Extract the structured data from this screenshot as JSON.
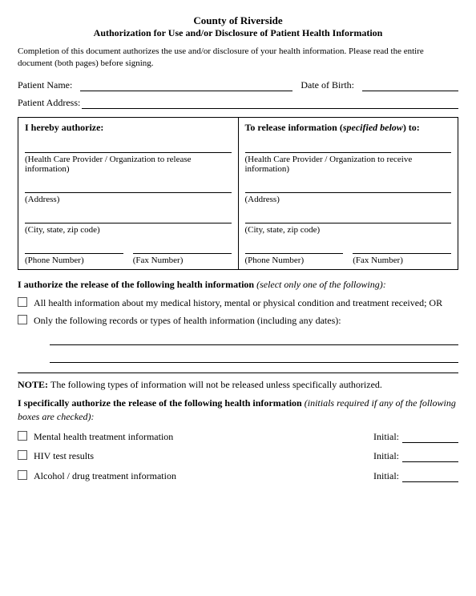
{
  "header": {
    "title": "County of Riverside",
    "subtitle": "Authorization for Use and/or Disclosure of Patient Health Information"
  },
  "intro": {
    "text": "Completion of this document authorizes the use and/or disclosure of your health information.  Please read the entire document (both pages) before signing."
  },
  "fields": {
    "patient_name_label": "Patient Name:",
    "date_of_birth_label": "Date of Birth:",
    "patient_address_label": "Patient Address:"
  },
  "authorize_table": {
    "left_header": "I hereby authorize:",
    "right_header": "To release information (specified below) to:",
    "left_provider": "(Health Care Provider / Organization to release information)",
    "right_provider": "(Health Care Provider / Organization to receive information)",
    "address_label": "(Address)",
    "city_label": "(City, state, zip code)",
    "phone_label": "(Phone Number)",
    "fax_label": "(Fax Number)"
  },
  "release_section": {
    "title_bold": "I authorize the release of the following health information",
    "title_italic": " (select only one of the following):",
    "option1": "All health information about my medical history, mental or physical condition and treatment received; OR",
    "option2": "Only the following records or types of health information (including any dates):"
  },
  "note_section": {
    "note_prefix": "NOTE: ",
    "note_text": " The following types of information will not be released unless specifically authorized.",
    "specific_bold": "I specifically authorize the release of the following health information",
    "specific_italic": " (initials required if any of the following boxes are checked):"
  },
  "specific_items": [
    {
      "label": "Mental health treatment information",
      "initial_label": "Initial:"
    },
    {
      "label": "HIV test results",
      "initial_label": "Initial:"
    },
    {
      "label": "Alcohol / drug treatment information",
      "initial_label": "Initial:"
    }
  ]
}
